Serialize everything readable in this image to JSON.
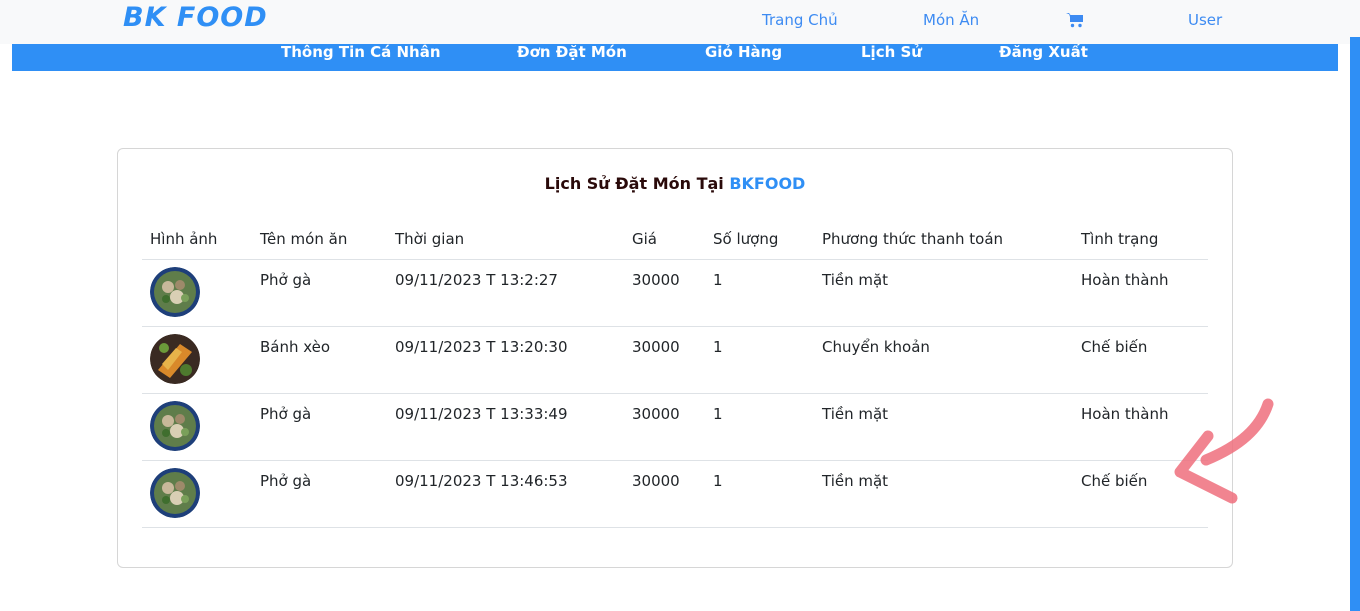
{
  "header": {
    "logo": "BK FOOD",
    "nav": [
      "Trang Chủ",
      "Món Ăn",
      "User"
    ],
    "cart_icon": "cart-icon"
  },
  "menu": [
    "Thông Tin Cá Nhân",
    "Đơn Đặt Món",
    "Giỏ Hàng",
    "Lịch Sử",
    "Đăng Xuất"
  ],
  "history": {
    "title": "Lịch Sử Đặt Món Tại ",
    "title_brand": "BKFOOD",
    "columns": [
      "Hình ảnh",
      "Tên món ăn",
      "Thời gian",
      "Giá",
      "Số lượng",
      "Phương thức thanh toán",
      "Tình trạng"
    ],
    "rows": [
      {
        "image": "pho-ga-image",
        "name": "Phở gà",
        "time": "09/11/2023 T 13:2:27",
        "price": "30000",
        "qty": "1",
        "payment": "Tiền mặt",
        "status": "Hoàn thành"
      },
      {
        "image": "banh-xeo-image",
        "name": "Bánh xèo",
        "time": "09/11/2023 T 13:20:30",
        "price": "30000",
        "qty": "1",
        "payment": "Chuyển khoản",
        "status": "Chế biến"
      },
      {
        "image": "pho-ga-image",
        "name": "Phở gà",
        "time": "09/11/2023 T 13:33:49",
        "price": "30000",
        "qty": "1",
        "payment": "Tiền mặt",
        "status": "Hoàn thành"
      },
      {
        "image": "pho-ga-image",
        "name": "Phở gà",
        "time": "09/11/2023 T 13:46:53",
        "price": "30000",
        "qty": "1",
        "payment": "Tiền mặt",
        "status": "Chế biến"
      }
    ]
  },
  "colors": {
    "accent": "#2f8ff5",
    "annotation": "#ef6f7c"
  }
}
